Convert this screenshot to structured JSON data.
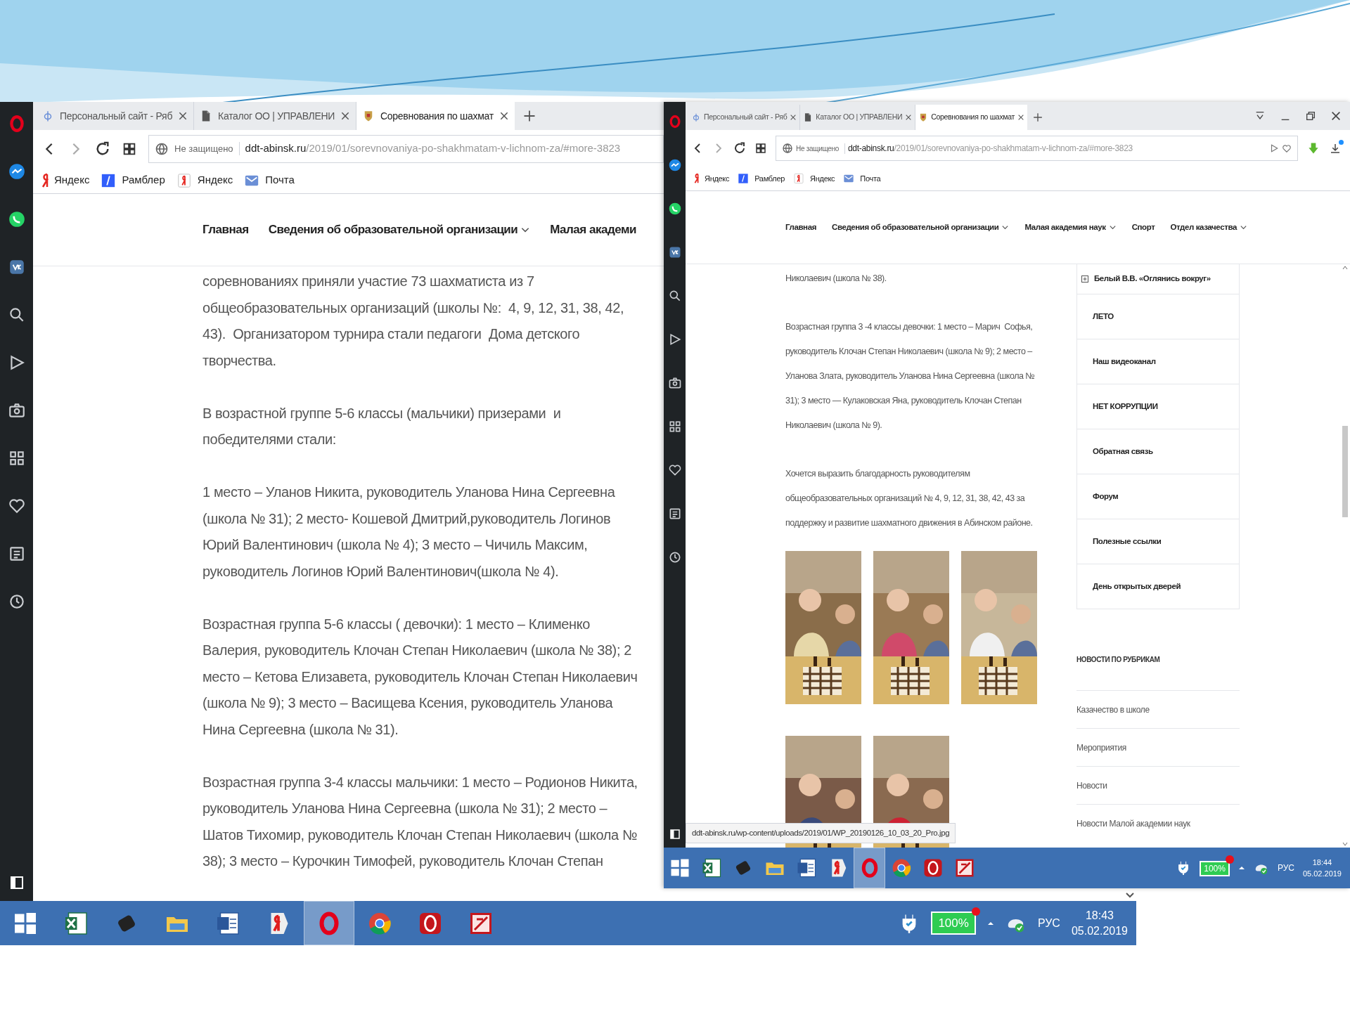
{
  "left_browser": {
    "tabs": [
      {
        "label": "Персональный сайт - Ряб",
        "selected": false
      },
      {
        "label": "Каталог ОО | УПРАВЛЕНИ",
        "selected": false
      },
      {
        "label": "Соревнования по шахмат",
        "selected": true
      }
    ],
    "address": {
      "security": "Не защищено",
      "domain": "ddt-abinsk.ru",
      "path": "/2019/01/sorevnovaniya-po-shakhmatam-v-lichnom-za/#more-3823"
    },
    "bookmarks": [
      {
        "label": "Яндекс",
        "kind": "yandex"
      },
      {
        "label": "Рамблер",
        "kind": "rambler"
      },
      {
        "label": "Яндекс",
        "kind": "yandex-box"
      },
      {
        "label": "Почта",
        "kind": "mail"
      }
    ],
    "nav": [
      {
        "label": "Главная",
        "dropdown": false
      },
      {
        "label": "Сведения об образовательной организации",
        "dropdown": true
      },
      {
        "label": "Малая академи",
        "dropdown": false
      }
    ],
    "paragraphs": [
      {
        "lines": [
          "соревнованиях приняли участие 73 шахматиста из 7",
          "общеобразовательных организаций (школы №:  4, 9, 12, 31, 38, 42,",
          "43).  Организатором турнира стали педагоги  Дома детского",
          "творчества."
        ]
      },
      {
        "lines": [
          "В возрастной группе 5-6 классы (мальчики) призерами  и",
          "победителями стали:"
        ]
      },
      {
        "lines": [
          "1 место – Уланов Никита, руководитель Уланова Нина Сергеевна",
          "(школа № 31); 2 место- Кошевой Дмитрий,руководитель Логинов",
          "Юрий Валентинович (школа № 4); 3 место – Чичиль Максим,",
          "руководитель Логинов Юрий Валентинович(школа № 4)."
        ]
      },
      {
        "lines": [
          "Возрастная группа 5-6 классы ( девочки): 1 место – Клименко",
          "Валерия, руководитель Клочан Степан Николаевич (школа № 38); 2",
          "место – Кетова Елизавета, руководитель Клочан Степан Николаевич",
          "(школа № 9); 3 место – Васищева Ксения, руководитель Уланова",
          "Нина Сергеевна (школа № 31)."
        ]
      },
      {
        "lines": [
          "Возрастная группа 3-4 классы мальчики: 1 место – Родионов Никита,",
          "руководитель Уланова Нина Сергеевна (школа № 31); 2 место –",
          "Шатов Тихомир, руководитель Клочан Степан Николаевич (школа №",
          "38); 3 место – Курочкин Тимофей, руководитель Клочан Степан"
        ]
      }
    ],
    "taskbar": {
      "apps": [
        {
          "kind": "start",
          "selected": false
        },
        {
          "kind": "excel",
          "selected": false
        },
        {
          "kind": "device",
          "selected": false
        },
        {
          "kind": "explorer",
          "selected": false
        },
        {
          "kind": "word",
          "selected": false
        },
        {
          "kind": "yandex",
          "selected": false
        },
        {
          "kind": "opera",
          "selected": true
        },
        {
          "kind": "chrome",
          "selected": false
        },
        {
          "kind": "opera-red",
          "selected": false
        },
        {
          "kind": "pdf",
          "selected": false
        }
      ],
      "battery": "100%",
      "language": "РУС",
      "time": "18:43",
      "date": "05.02.2019"
    }
  },
  "right_browser": {
    "tabs": [
      {
        "label": "Персональный сайт - Ряб",
        "selected": false
      },
      {
        "label": "Каталог ОО | УПРАВЛЕНИ",
        "selected": false
      },
      {
        "label": "Соревнования по шахмат",
        "selected": true
      }
    ],
    "address": {
      "security": "Не защищено",
      "domain": "ddt-abinsk.ru",
      "path": "/2019/01/sorevnovaniya-po-shakhmatam-v-lichnom-za/#more-3823"
    },
    "bookmarks": [
      {
        "label": "Яндекс",
        "kind": "yandex"
      },
      {
        "label": "Рамблер",
        "kind": "rambler"
      },
      {
        "label": "Яндекс",
        "kind": "yandex-box"
      },
      {
        "label": "Почта",
        "kind": "mail"
      }
    ],
    "nav": [
      {
        "label": "Главная",
        "dropdown": false
      },
      {
        "label": "Сведения об образовательной организации",
        "dropdown": true
      },
      {
        "label": "Малая академия наук",
        "dropdown": true
      },
      {
        "label": "Спорт",
        "dropdown": false
      },
      {
        "label": "Отдел казачества",
        "dropdown": true
      }
    ],
    "paragraphs": [
      {
        "lines": [
          "Николаевич (школа № 38)."
        ]
      },
      {
        "lines": [
          "Возрастная группа 3 -4 классы девочки: 1 место – Марич  Софья,",
          "руководитель Клочан Степан Николаевич (школа № 9); 2 место –",
          "Уланова Злата, руководитель Уланова Нина Сергеевна (школа №",
          "31); 3 место — Кулаковская Яна, руководитель Клочан Степан",
          "Николаевич (школа № 9)."
        ]
      },
      {
        "lines": [
          "Хочется выразить благодарность руководителям",
          "общеобразовательных организаций № 4, 9, 12, 31, 38, 42, 43 за",
          "поддержку и развитие шахматного движения в Абинском районе."
        ]
      }
    ],
    "photos": [
      {
        "kind": "picture"
      },
      {
        "kind": "picture"
      },
      {
        "kind": "picture"
      },
      {
        "kind": "picture"
      },
      {
        "kind": "picture"
      }
    ],
    "status_url": "ddt-abinsk.ru/wp-content/uploads/2019/01/WP_20190126_10_03_20_Pro.jpg",
    "menu": [
      {
        "label": "Белый В.В. «Оглянись вокруг»",
        "expandable": true
      },
      {
        "label": "ЛЕТО",
        "expandable": false
      },
      {
        "label": "Наш видеоканал",
        "expandable": false
      },
      {
        "label": "НЕТ КОРРУПЦИИ",
        "expandable": false
      },
      {
        "label": "Обратная связь",
        "expandable": false
      },
      {
        "label": "Форум",
        "expandable": false
      },
      {
        "label": "Полезные ссылки",
        "expandable": false
      },
      {
        "label": "День открытых дверей",
        "expandable": false
      }
    ],
    "rubrics_heading": "НОВОСТИ ПО РУБРИКАМ",
    "rubrics": [
      "Казачество в школе",
      "Мероприятия",
      "Новости",
      "Новости Малой академии наук"
    ],
    "taskbar": {
      "apps": [
        {
          "kind": "start",
          "selected": false
        },
        {
          "kind": "excel",
          "selected": false
        },
        {
          "kind": "device",
          "selected": false
        },
        {
          "kind": "explorer",
          "selected": false
        },
        {
          "kind": "word",
          "selected": false
        },
        {
          "kind": "yandex",
          "selected": false
        },
        {
          "kind": "opera",
          "selected": true
        },
        {
          "kind": "chrome",
          "selected": false
        },
        {
          "kind": "opera-red",
          "selected": false
        },
        {
          "kind": "pdf",
          "selected": false
        }
      ],
      "battery": "100%",
      "language": "РУС",
      "time": "18:44",
      "date": "05.02.2019"
    }
  }
}
